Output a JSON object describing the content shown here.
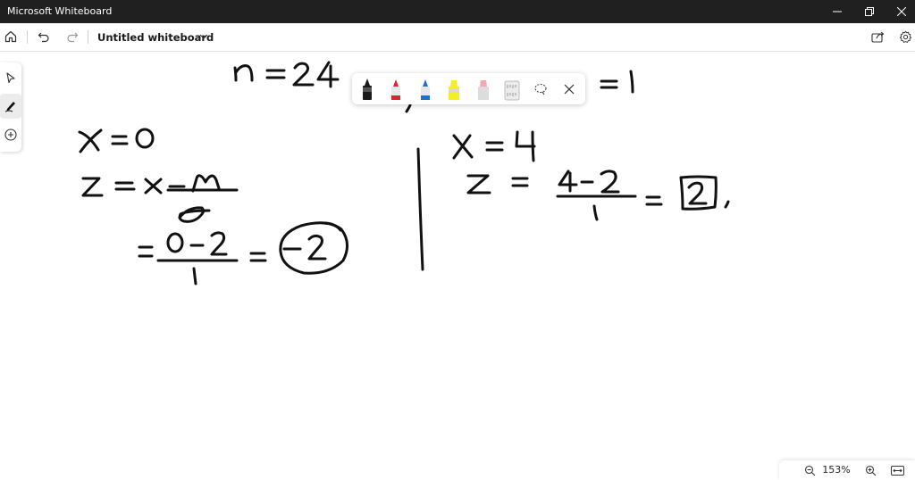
{
  "window": {
    "app_title": "Microsoft Whiteboard"
  },
  "toolbar": {
    "board_title": "Untitled whiteboard"
  },
  "zoom": {
    "level": "153%"
  },
  "icons": {
    "home": "home-icon",
    "undo": "undo-icon",
    "redo": "redo-icon",
    "title_menu": "chevron-down-icon",
    "share": "share-icon",
    "settings": "gear-icon",
    "select": "select-arrow-icon",
    "pen": "pen-icon",
    "add": "add-icon",
    "lasso": "lasso-icon",
    "close": "close-icon",
    "zoom_out": "zoom-out-icon",
    "zoom_in": "zoom-in-icon",
    "fit": "fit-to-screen-icon"
  },
  "colors": {
    "titlebar": "#202020",
    "pen_black": "#1b1b1b",
    "pen_red": "#e0222f",
    "pen_blue": "#1f6fd1",
    "highlighter_yellow": "#f4ef1e",
    "highlighter_pink": "#f2a8b5",
    "ink": "#111111"
  }
}
